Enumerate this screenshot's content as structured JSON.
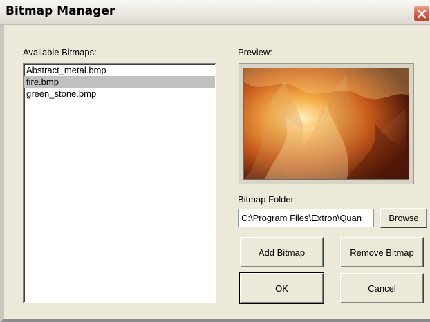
{
  "window": {
    "title": "Bitmap Manager"
  },
  "available": {
    "label": "Available Bitmaps:",
    "items": [
      "Abstract_metal.bmp",
      "fire.bmp",
      "green_stone.bmp"
    ],
    "selected_index": 1
  },
  "preview": {
    "label": "Preview:"
  },
  "folder": {
    "label": "Bitmap Folder:",
    "value": "C:\\Program Files\\Extron\\Quan",
    "browse_label": "Browse"
  },
  "buttons": {
    "add": "Add Bitmap",
    "remove": "Remove Bitmap",
    "ok": "OK",
    "cancel": "Cancel"
  },
  "icons": {
    "close": "close-icon"
  },
  "colors": {
    "close_button": "#d7614a",
    "selection": "#c0c0c0",
    "dialog": "#ece9d8"
  }
}
